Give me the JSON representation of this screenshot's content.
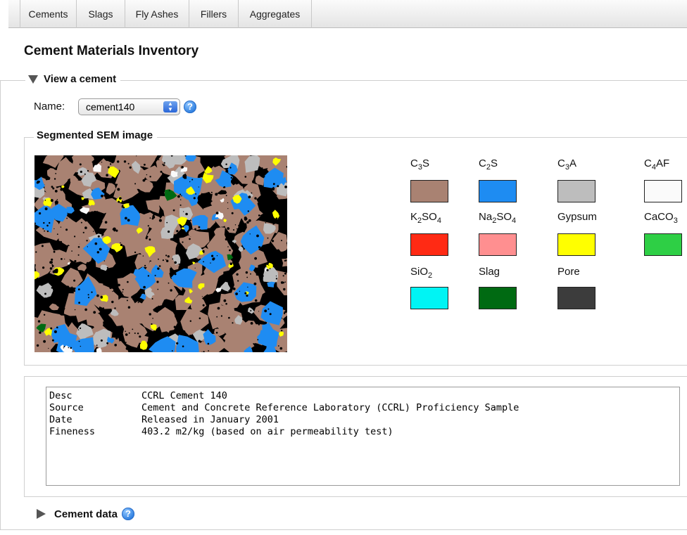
{
  "tabs": [
    {
      "label": "Cements"
    },
    {
      "label": "Slags"
    },
    {
      "label": "Fly Ashes"
    },
    {
      "label": "Fillers"
    },
    {
      "label": "Aggregates"
    }
  ],
  "page_title": "Cement Materials Inventory",
  "view_section": {
    "legend": "View a cement",
    "name_label": "Name:",
    "selected_cement": "cement140",
    "help_glyph": "?"
  },
  "sem_section": {
    "legend": "Segmented SEM image",
    "phases": [
      {
        "base": "C",
        "sub1": "3",
        "mid": "S",
        "sub2": "",
        "tail": "",
        "color": "#a98272"
      },
      {
        "base": "C",
        "sub1": "2",
        "mid": "S",
        "sub2": "",
        "tail": "",
        "color": "#1e8cf2"
      },
      {
        "base": "C",
        "sub1": "3",
        "mid": "A",
        "sub2": "",
        "tail": "",
        "color": "#bdbdbd"
      },
      {
        "base": "C",
        "sub1": "4",
        "mid": "AF",
        "sub2": "",
        "tail": "",
        "color": "#fafafa"
      },
      {
        "base": "K",
        "sub1": "2",
        "mid": "SO",
        "sub2": "4",
        "tail": "",
        "color": "#ff2a14"
      },
      {
        "base": "Na",
        "sub1": "2",
        "mid": "SO",
        "sub2": "4",
        "tail": "",
        "color": "#ff8f90"
      },
      {
        "base": "Gypsum",
        "sub1": "",
        "mid": "",
        "sub2": "",
        "tail": "",
        "color": "#ffff00"
      },
      {
        "base": "CaCO",
        "sub1": "3",
        "mid": "",
        "sub2": "",
        "tail": "",
        "color": "#2ecf45"
      },
      {
        "base": "SiO",
        "sub1": "2",
        "mid": "",
        "sub2": "",
        "tail": "",
        "color": "#00f4f4"
      },
      {
        "base": "Slag",
        "sub1": "",
        "mid": "",
        "sub2": "",
        "tail": "",
        "color": "#006a12"
      },
      {
        "base": "Pore",
        "sub1": "",
        "mid": "",
        "sub2": "",
        "tail": "",
        "color": "#3c3c3c"
      }
    ]
  },
  "description": [
    {
      "key": "Desc",
      "value": "CCRL Cement 140"
    },
    {
      "key": "Source",
      "value": "Cement and Concrete Reference Laboratory (CCRL) Proficiency Sample"
    },
    {
      "key": "Date",
      "value": "Released in January 2001"
    },
    {
      "key": "Fineness",
      "value": "403.2 m2/kg (based on air permeability test)"
    }
  ],
  "cement_data": {
    "legend": "Cement data",
    "help_glyph": "?"
  }
}
